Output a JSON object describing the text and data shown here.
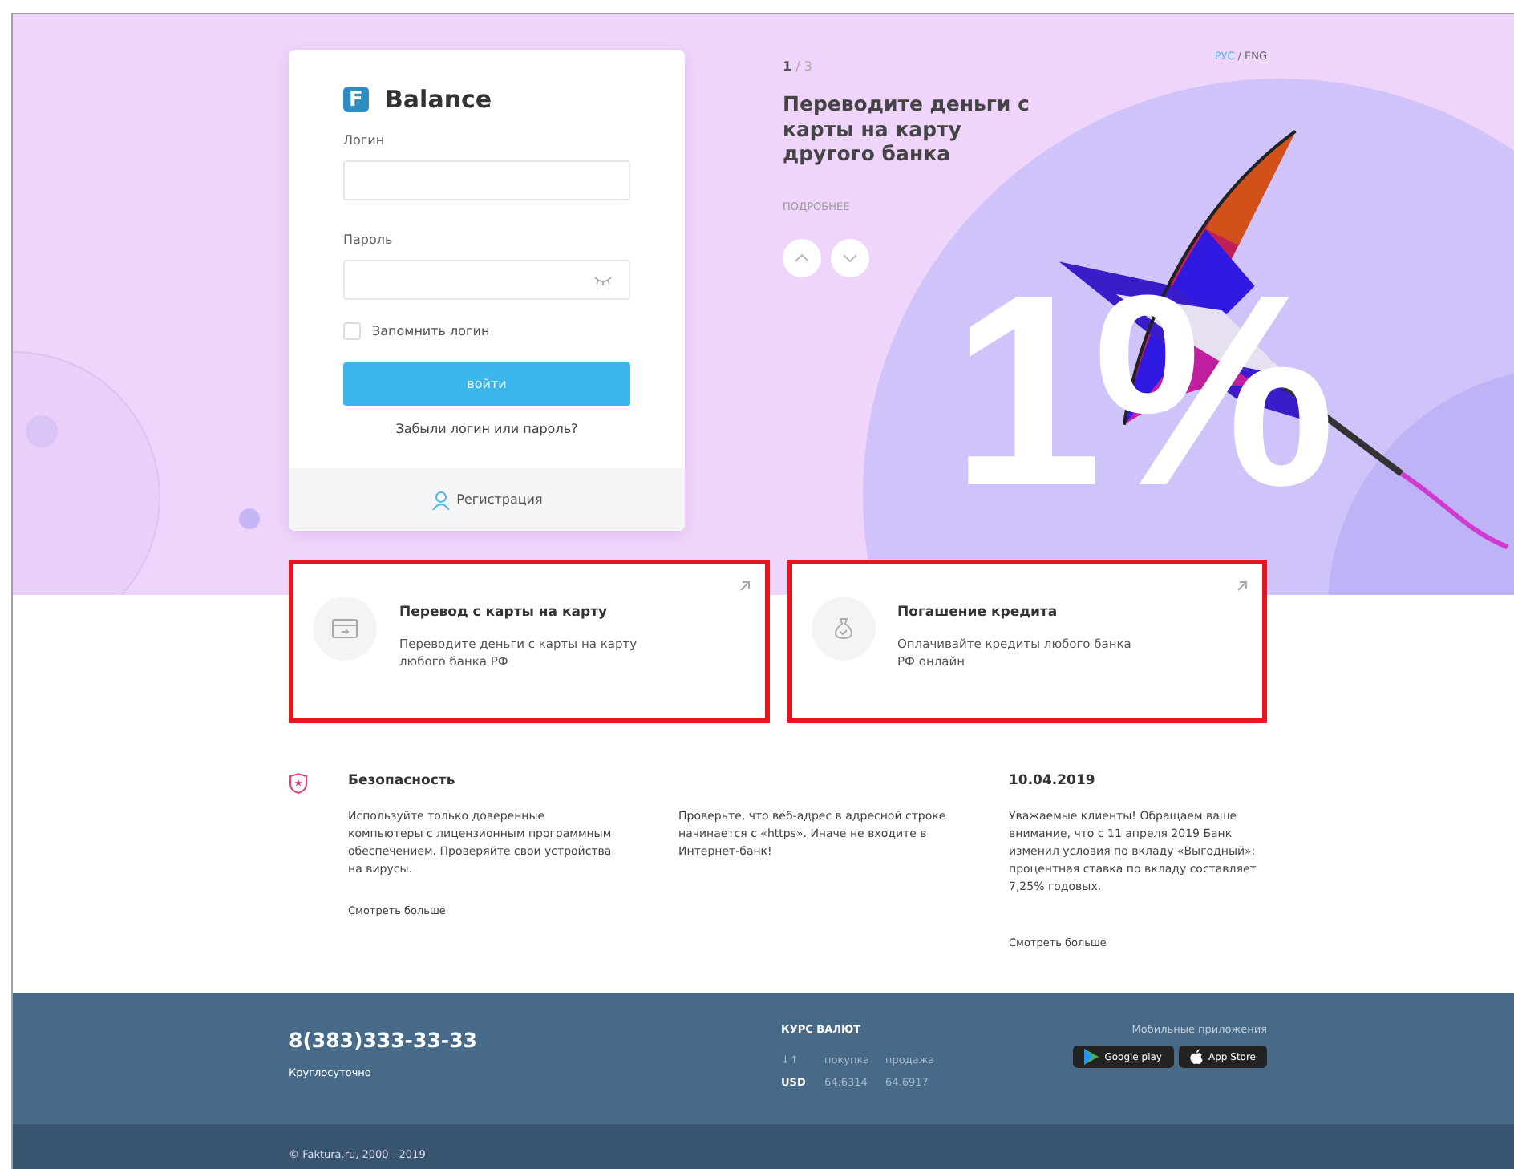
{
  "login": {
    "brand": "Balance",
    "logo_letter": "F",
    "login_label": "Логин",
    "password_label": "Пароль",
    "remember": {
      "label": "Запомнить логин",
      "checked": false
    },
    "submit": "войти",
    "forgot": "Забыли логин или пароль?",
    "register": "Регистрация"
  },
  "language": [
    {
      "label": "РУС",
      "selected": true
    },
    {
      "label": "ENG",
      "selected": false
    }
  ],
  "language_separator": "/",
  "slide": {
    "current": "1",
    "separator": "/",
    "total": "3",
    "title": "Переводите деньги с карты на карту другого банка",
    "more": "ПОДРОБНЕЕ",
    "big_number": "1%"
  },
  "services": [
    {
      "kind": "card",
      "title": "Перевод с карты на карту",
      "text": "Переводите деньги с карты на карту любого банка РФ",
      "highlighted": true
    },
    {
      "kind": "loan",
      "title": "Погашение кредита",
      "text": "Оплачивайте кредиты любого банка РФ онлайн",
      "highlighted": true
    }
  ],
  "security": {
    "title": "Безопасность",
    "text": "Используйте только доверенные компьютеры с лицензионным программным обеспечением. Проверяйте свои устройства на вирусы.",
    "more": "Смотреть больше",
    "text_2": "Проверьте, что веб-адрес в адресной строке начинается с «https». Иначе не входите в Интернет-банк!"
  },
  "news": {
    "date": "10.04.2019",
    "text": "Уважаемые клиенты! Обращаем ваше внимание, что с 11 апреля 2019 Банк изменил условия по вкладу «Выгодный»: процентная ставка по вкладу составляет 7,25% годовых.",
    "more": "Смотреть больше"
  },
  "footer": {
    "phone": "8(383)333-33-33",
    "phone_note": "Круглосуточно",
    "rates_title": "КУРС ВАЛЮТ",
    "rates_header": [
      "↓↑",
      "покупка",
      "продажа"
    ],
    "rates": [
      [
        "USD",
        "64.6314",
        "64.6917"
      ]
    ],
    "apps_title": "Мобильные приложения",
    "apps": [
      {
        "kind": "google",
        "label": "Google play"
      },
      {
        "kind": "apple",
        "label": "App Store"
      }
    ],
    "copyright": "© Faktura.ru, 2000 - 2019"
  }
}
